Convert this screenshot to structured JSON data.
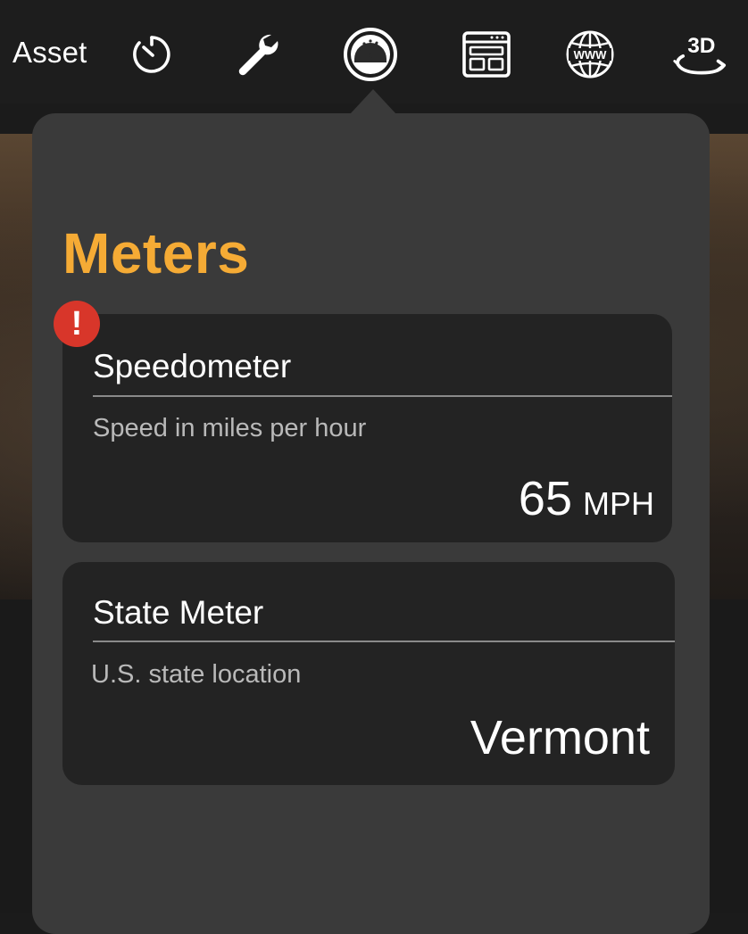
{
  "toolbar": {
    "title": "Asset",
    "tabs": [
      {
        "icon": "timer-icon"
      },
      {
        "icon": "wrench-icon"
      },
      {
        "icon": "gauge-icon",
        "selected": true
      },
      {
        "icon": "layout-icon"
      },
      {
        "icon": "globe-www-icon",
        "label": "WWW"
      },
      {
        "icon": "rotate-3d-icon",
        "label": "3D"
      }
    ]
  },
  "popover": {
    "title": "Meters",
    "title_color": "#f5ab35"
  },
  "meters": [
    {
      "name": "Speedometer",
      "description": "Speed in miles per hour",
      "value": "65",
      "unit": "MPH",
      "alert": "!"
    },
    {
      "name": "State Meter",
      "description": "U.S. state location",
      "value": "Vermont"
    }
  ],
  "colors": {
    "alert": "#d8362a",
    "card_bg": "#232323",
    "popover_bg": "#3a3a3a"
  }
}
